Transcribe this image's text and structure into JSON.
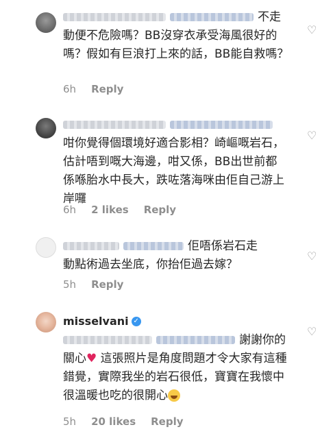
{
  "comments": [
    {
      "text": "不走動便不危險嗎？BB沒穿衣承受海風很好的嗎？假如有巨浪打上來的話，BB能自救嗎？",
      "time": "6h",
      "likes": "",
      "reply": "Reply"
    },
    {
      "text": "咁你覺得個環境好適合影相？崎嶇嘅岩石，估計唔到嘅大海邊，咁又係，BB出世前都係喺胎水中長大，跌咗落海咪由佢自己游上岸囉",
      "time": "6h",
      "likes": "2 likes",
      "reply": "Reply"
    },
    {
      "text": "佢唔係岩石走動點術過去坐底，你抬佢過去嫁？",
      "time": "5h",
      "likes": "",
      "reply": "Reply"
    },
    {
      "username": "misselvani",
      "text_a": "謝謝你的關心",
      "text_b": "這張照片是角度問題才令大家有這種錯覺，實際我坐的岩石很低，寶寶在我懷中很溫暖也吃的很開心",
      "time": "5h",
      "likes": "20 likes",
      "reply": "Reply"
    }
  ],
  "icons": {
    "heart": "heart-outline-icon",
    "verified": "verified-badge-icon",
    "red_heart": "red-heart-emoji",
    "laugh": "laughing-emoji"
  },
  "colors": {
    "text": "#262626",
    "muted": "#8e8e8e",
    "verified": "#3897f0"
  }
}
